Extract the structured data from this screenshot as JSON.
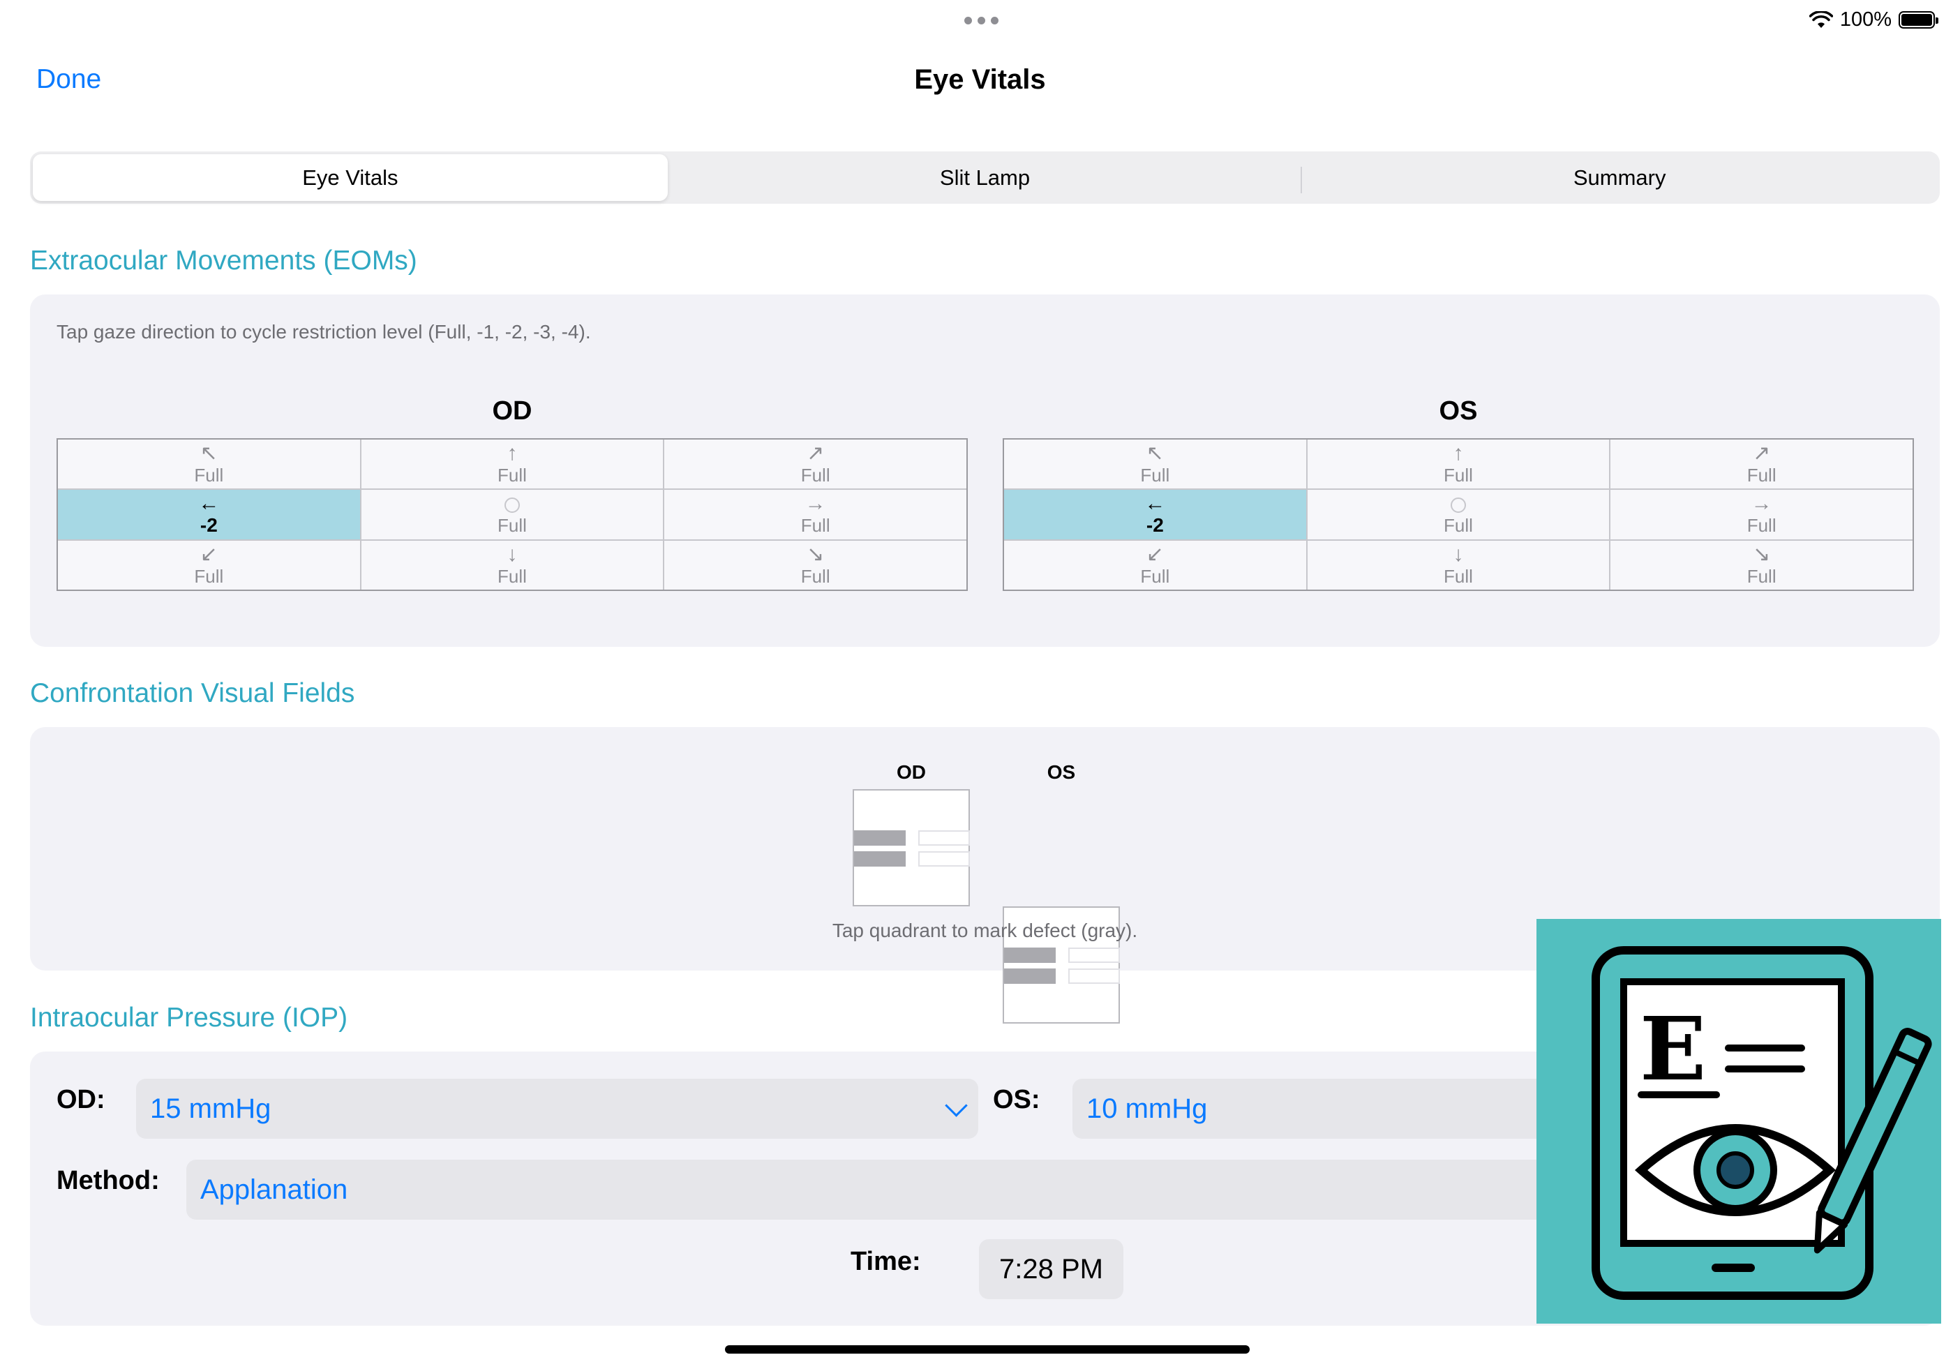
{
  "status": {
    "battery": "100%"
  },
  "nav": {
    "done": "Done",
    "title": "Eye Vitals"
  },
  "tabs": [
    {
      "label": "Eye Vitals",
      "active": true
    },
    {
      "label": "Slit Lamp",
      "active": false
    },
    {
      "label": "Summary",
      "active": false
    }
  ],
  "eom": {
    "title": "Extraocular Movements (EOMs)",
    "hint": "Tap gaze direction to cycle restriction level (Full, -1, -2, -3, -4).",
    "od": {
      "label": "OD",
      "cells": [
        {
          "icon": "arrow-up-left-icon",
          "glyph": "↖",
          "value": "Full"
        },
        {
          "icon": "arrow-up-icon",
          "glyph": "↑",
          "value": "Full"
        },
        {
          "icon": "arrow-up-right-icon",
          "glyph": "↗",
          "value": "Full"
        },
        {
          "icon": "arrow-left-icon",
          "glyph": "←",
          "value": "-2",
          "selected": true
        },
        {
          "icon": "center-circle-icon",
          "glyph": "",
          "value": "Full"
        },
        {
          "icon": "arrow-right-icon",
          "glyph": "→",
          "value": "Full"
        },
        {
          "icon": "arrow-down-left-icon",
          "glyph": "↙",
          "value": "Full"
        },
        {
          "icon": "arrow-down-icon",
          "glyph": "↓",
          "value": "Full"
        },
        {
          "icon": "arrow-down-right-icon",
          "glyph": "↘",
          "value": "Full"
        }
      ]
    },
    "os": {
      "label": "OS",
      "cells": [
        {
          "icon": "arrow-up-left-icon",
          "glyph": "↖",
          "value": "Full"
        },
        {
          "icon": "arrow-up-icon",
          "glyph": "↑",
          "value": "Full"
        },
        {
          "icon": "arrow-up-right-icon",
          "glyph": "↗",
          "value": "Full"
        },
        {
          "icon": "arrow-left-icon",
          "glyph": "←",
          "value": "-2",
          "selected": true
        },
        {
          "icon": "center-circle-icon",
          "glyph": "",
          "value": "Full"
        },
        {
          "icon": "arrow-right-icon",
          "glyph": "→",
          "value": "Full"
        },
        {
          "icon": "arrow-down-left-icon",
          "glyph": "↙",
          "value": "Full"
        },
        {
          "icon": "arrow-down-icon",
          "glyph": "↓",
          "value": "Full"
        },
        {
          "icon": "arrow-down-right-icon",
          "glyph": "↘",
          "value": "Full"
        }
      ]
    }
  },
  "cvf": {
    "title": "Confrontation Visual Fields",
    "od_label": "OD",
    "os_label": "OS",
    "hint": "Tap quadrant to mark defect (gray).",
    "defect_color": "#a9a9ae"
  },
  "iop": {
    "title": "Intraocular Pressure (IOP)",
    "od_label": "OD:",
    "od_value": "15 mmHg",
    "os_label": "OS:",
    "os_value": "10 mmHg",
    "method_label": "Method:",
    "method_value": "Applanation",
    "time_label": "Time:",
    "time_value": "7:28 PM"
  },
  "colors": {
    "accent": "#0a7aff",
    "section": "#30a8c2",
    "selected_cell": "#a6d8e4",
    "logo_bg": "#52bfbf"
  }
}
